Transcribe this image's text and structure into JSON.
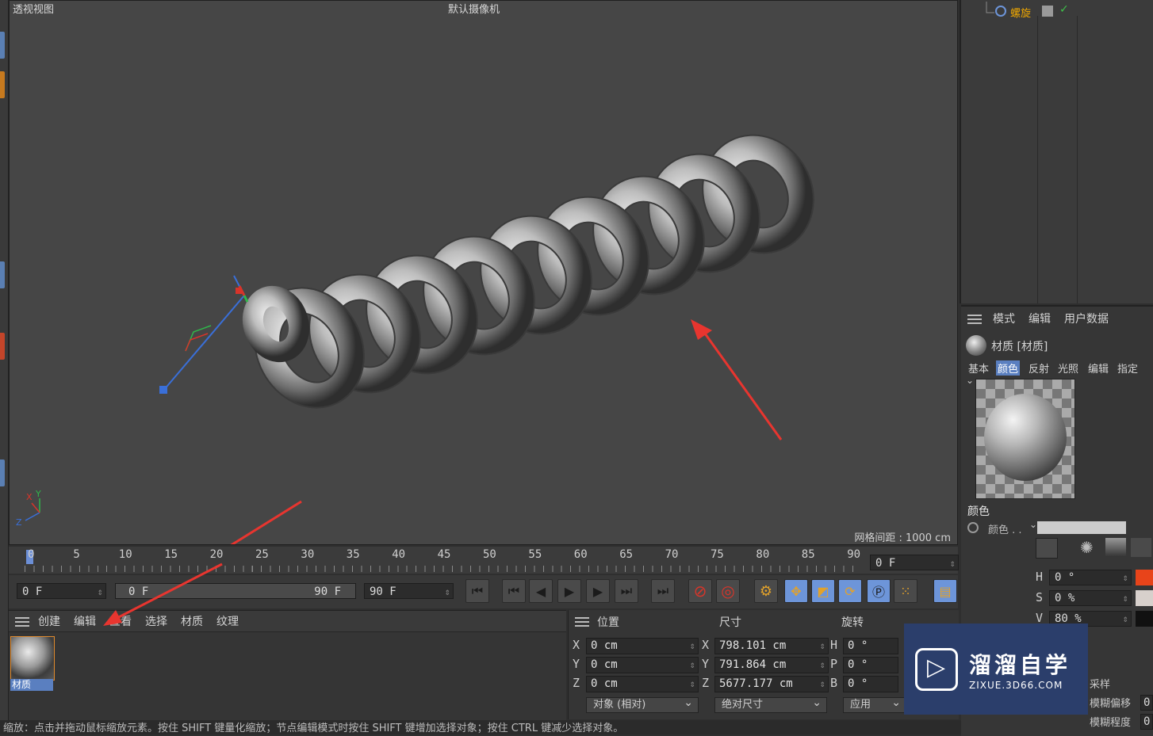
{
  "viewport": {
    "title": "透视视图",
    "camera": "默认摄像机",
    "grid_spacing": "网格间距 : 1000 cm"
  },
  "timeline": {
    "ticks": [
      "0",
      "5",
      "10",
      "15",
      "20",
      "25",
      "30",
      "35",
      "40",
      "45",
      "50",
      "55",
      "60",
      "65",
      "70",
      "75",
      "80",
      "85",
      "90"
    ],
    "current_frame": "0 F",
    "start_frame": "0 F",
    "range_start": "0 F",
    "range_end": "90 F",
    "end_frame": "90 F"
  },
  "materials": {
    "menu": [
      "创建",
      "编辑",
      "查看",
      "选择",
      "材质",
      "纹理"
    ],
    "items": [
      {
        "label": "材质"
      }
    ]
  },
  "coordinates": {
    "headers": {
      "position": "位置",
      "size": "尺寸",
      "rotation": "旋转"
    },
    "rows": [
      {
        "axis": "X",
        "pos": "0 cm",
        "size_axis": "X",
        "size": "798.101 cm",
        "rot_axis": "H",
        "rot": "0 °"
      },
      {
        "axis": "Y",
        "pos": "0 cm",
        "size_axis": "Y",
        "size": "791.864 cm",
        "rot_axis": "P",
        "rot": "0 °"
      },
      {
        "axis": "Z",
        "pos": "0 cm",
        "size_axis": "Z",
        "size": "5677.177 cm",
        "rot_axis": "B",
        "rot": "0 °"
      }
    ],
    "mode_dropdown": "对象 (相对)",
    "size_dropdown": "绝对尺寸",
    "apply_button": "应用"
  },
  "object_manager": {
    "object_name": "螺旋"
  },
  "attributes": {
    "menu": [
      "模式",
      "编辑",
      "用户数据"
    ],
    "header": "材质 [材质]",
    "tabs": [
      "基本",
      "颜色",
      "反射",
      "光照",
      "编辑",
      "指定"
    ],
    "active_tab": "颜色",
    "section": "颜色",
    "color_label": "颜色 . .",
    "h_label": "H",
    "h_value": "0 °",
    "s_label": "S",
    "s_value": "0 %",
    "v_label": "V",
    "v_value": "80 %",
    "sampling": "采样",
    "blur_offset": "模糊偏移",
    "blur_degree": "模糊程度",
    "blur_offset_value": "0",
    "blur_degree_value": "0"
  },
  "status": {
    "text": "缩放：点击并拖动鼠标缩放元素。按住 SHIFT 键量化缩放；节点编辑模式时按住 SHIFT 键增加选择对象；按住 CTRL 键减少选择对象。"
  },
  "watermark": {
    "brand": "溜溜自学",
    "url": "ZIXUE.3D66.COM"
  },
  "colors": {
    "accent_blue": "#6d95d9",
    "object_name": "#f0a800",
    "arrow_red": "#e8352f"
  }
}
